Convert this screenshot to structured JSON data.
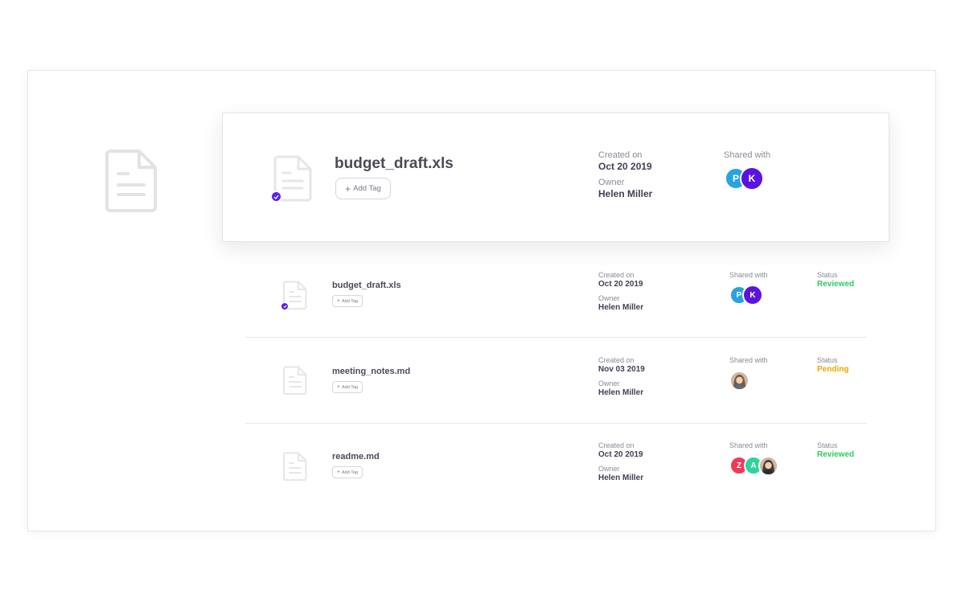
{
  "tag_button_label": "Add Tag",
  "colors": {
    "accent": "#5b21e6",
    "reviewed": "#2ecc5e",
    "pending": "#f0a500",
    "avatar_p": "#29a3dd",
    "avatar_k": "#5b13e0",
    "avatar_z": "#ef3b5a",
    "avatar_a": "#2fd39a"
  },
  "featured": {
    "filename": "budget_draft.xls",
    "icon": "document-icon",
    "selected": true,
    "created_label": "Created on",
    "created_value": "Oct 20 2019",
    "owner_label": "Owner",
    "owner_value": "Helen Miller",
    "shared_label": "Shared with",
    "shared": [
      "P",
      "K"
    ]
  },
  "rows": [
    {
      "filename": "budget_draft.xls",
      "selected": true,
      "created_label": "Created on",
      "created_value": "Oct 20 2019",
      "owner_label": "Owner",
      "owner_value": "Helen Miller",
      "shared_label": "Shared with",
      "shared": [
        "P",
        "K"
      ],
      "status_label": "Status",
      "status_value": "Reviewed"
    },
    {
      "filename": "meeting_notes.md",
      "selected": false,
      "created_label": "Created on",
      "created_value": "Nov 03 2019",
      "owner_label": "Owner",
      "owner_value": "Helen Miller",
      "shared_label": "Shared with",
      "shared": [
        "photo"
      ],
      "status_label": "Status",
      "status_value": "Pending"
    },
    {
      "filename": "readme.md",
      "selected": false,
      "created_label": "Created on",
      "created_value": "Oct 20 2019",
      "owner_label": "Owner",
      "owner_value": "Helen Miller",
      "shared_label": "Shared with",
      "shared": [
        "Z",
        "A",
        "photo"
      ],
      "status_label": "Status",
      "status_value": "Reviewed"
    }
  ]
}
